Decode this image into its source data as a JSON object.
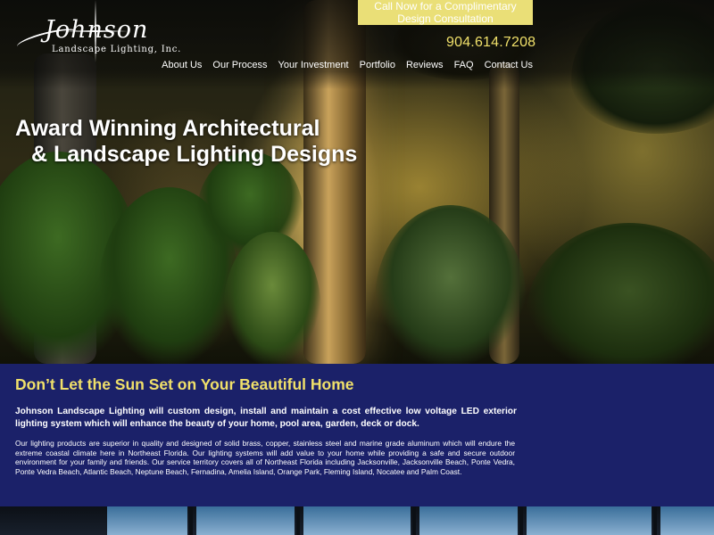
{
  "logo": {
    "name": "Johnson",
    "subtitle": "Landscape Lighting, Inc."
  },
  "cta": {
    "line1": "Call Now for a Complimentary",
    "line2": "Design Consultation"
  },
  "phone": "904.614.7208",
  "nav": [
    {
      "label": "About Us"
    },
    {
      "label": "Our Process"
    },
    {
      "label": "Your Investment"
    },
    {
      "label": "Portfolio"
    },
    {
      "label": "Reviews"
    },
    {
      "label": "FAQ"
    },
    {
      "label": "Contact Us"
    }
  ],
  "hero": {
    "line1": "Award Winning Architectural",
    "line2": "& Landscape Lighting Designs"
  },
  "content": {
    "heading": "Don’t Let the Sun Set on Your Beautiful Home",
    "lead": "Johnson Landscape Lighting will custom design, install and maintain a cost effective low voltage LED exterior lighting system which will enhance the beauty of your home, pool area, garden, deck or dock.",
    "body": "Our lighting products are superior in quality and designed of solid brass, copper, stainless steel and marine grade aluminum which will endure the extreme coastal climate here in Northeast Florida.  Our lighting systems will add value to your home while providing a safe and secure outdoor environment for your family and friends.  Our service territory covers all of Northeast Florida including Jacksonville, Jacksonville Beach, Ponte Vedra, Ponte Vedra Beach, Atlantic Beach, Neptune Beach, Fernadina, Amelia Island, Orange Park, Fleming Island, Nocatee and Palm Coast."
  },
  "colors": {
    "accent_yellow": "#f0e06a",
    "cta_bg": "#eadf77",
    "band_blue": "#1b2169"
  }
}
